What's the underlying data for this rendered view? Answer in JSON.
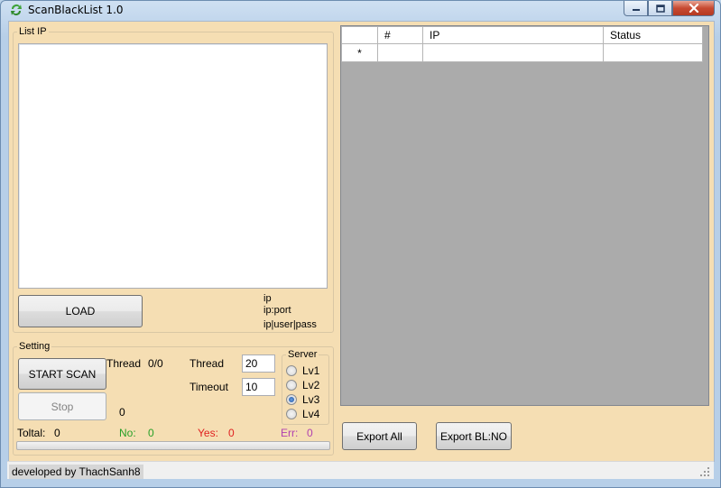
{
  "window": {
    "title": "ScanBlackList 1.0"
  },
  "list_ip": {
    "group_label": "List IP",
    "textarea_value": "",
    "load_button": "LOAD",
    "formats": [
      "ip",
      "ip:port",
      "ip|user|pass"
    ]
  },
  "setting": {
    "group_label": "Setting",
    "start_button": "START SCAN",
    "stop_button": "Stop",
    "thread_status_label": "Thread",
    "thread_status_value": "0/0",
    "thread_label": "Thread",
    "thread_value": "20",
    "timeout_label": "Timeout",
    "timeout_value": "10",
    "active_count": "0",
    "server": {
      "group_label": "Server",
      "options": [
        "Lv1",
        "Lv2",
        "Lv3",
        "Lv4"
      ],
      "selected": "Lv3"
    },
    "totals": {
      "total_label": "Toltal:",
      "total_value": "0",
      "no_label": "No:",
      "no_value": "0",
      "yes_label": "Yes:",
      "yes_value": "0",
      "err_label": "Err:",
      "err_value": "0"
    },
    "progress": 0
  },
  "grid": {
    "columns": [
      "",
      "#",
      "IP",
      "Status"
    ],
    "new_row_marker": "*"
  },
  "export": {
    "all_button": "Export All",
    "bl_no_button": "Export BL:NO"
  },
  "statusbar": {
    "text": "developed by ThachSanh8"
  },
  "colors": {
    "panel_bg": "#f5deb3",
    "no_color": "#28a028",
    "yes_color": "#e02020",
    "err_color": "#b040b0",
    "grid_bg": "#ababab"
  },
  "icons": {
    "app": "refresh-arrows-icon",
    "minimize": "minimize-icon",
    "maximize": "maximize-icon",
    "close": "close-icon"
  }
}
